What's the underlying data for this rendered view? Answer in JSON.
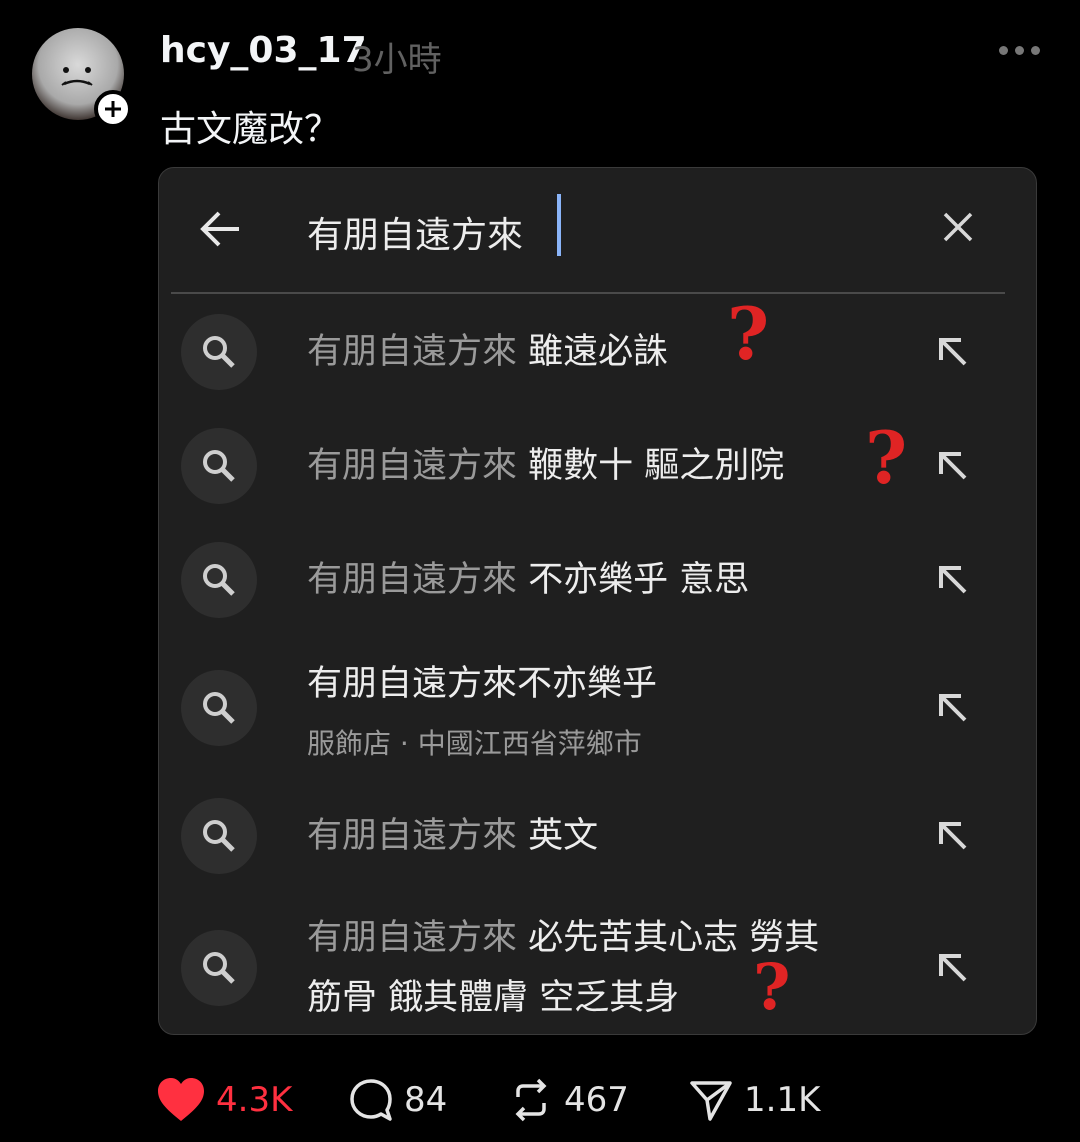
{
  "post": {
    "username": "hcy_03_17",
    "timestamp": "3小時",
    "text": "古文魔改？"
  },
  "search": {
    "query": "有朋自遠方來",
    "suggestions": [
      {
        "prefix": "有朋自遠方來 ",
        "rest": "雖遠必誅",
        "sub": ""
      },
      {
        "prefix": "有朋自遠方來 ",
        "rest": "鞭數十 驅之別院",
        "sub": ""
      },
      {
        "prefix": "有朋自遠方來 ",
        "rest": "不亦樂乎 意思",
        "sub": ""
      },
      {
        "prefix": "",
        "rest": "有朋自遠方來不亦樂乎",
        "sub": "服飾店 · 中國江西省萍鄉市"
      },
      {
        "prefix": "有朋自遠方來 ",
        "rest": "英文",
        "sub": ""
      },
      {
        "prefix": "有朋自遠方來 ",
        "rest": "必先苦其心志 勞其",
        "line2": "筋骨 餓其體膚 空乏其身",
        "sub": ""
      }
    ]
  },
  "annotations": {
    "mark": "?"
  },
  "actions": {
    "likes": "4.3K",
    "comments": "84",
    "reposts": "467",
    "shares": "1.1K"
  },
  "colors": {
    "like": "#ff3040",
    "annotation": "#e02424",
    "cursor": "#8ab4f8"
  },
  "icons": [
    "plus-icon",
    "more-icon",
    "back-arrow-icon",
    "close-icon",
    "search-icon",
    "fill-arrow-icon",
    "heart-icon",
    "comment-icon",
    "repost-icon",
    "share-icon"
  ]
}
